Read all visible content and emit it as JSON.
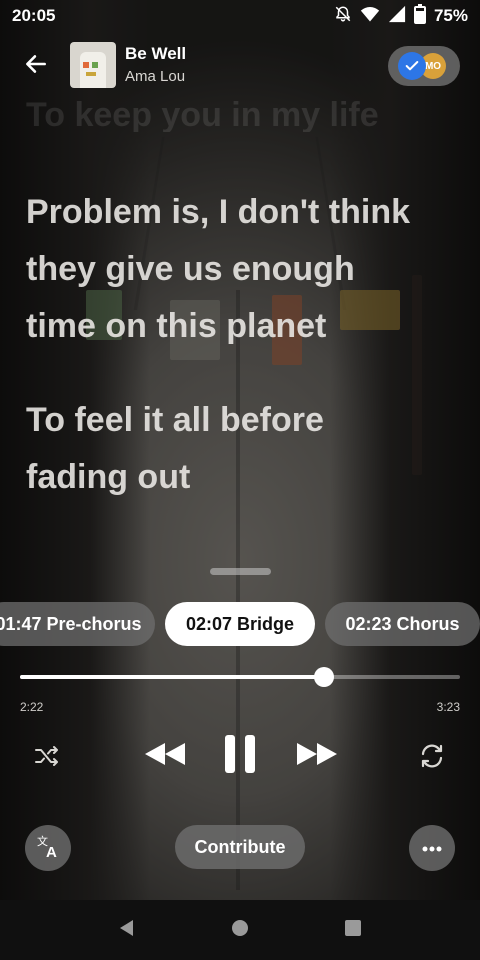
{
  "status_bar": {
    "time": "20:05",
    "battery": "75%"
  },
  "header": {
    "title": "Be Well",
    "artist": "Ama Lou",
    "toggle_badge": "MO"
  },
  "lyrics": {
    "previous_line_faded": "To keep you in my life",
    "current_lines": [
      "Problem is, I don't think",
      "they give us enough",
      "time on this planet"
    ],
    "next_lines": [
      "To feel it all before",
      "fading out"
    ]
  },
  "sections": [
    {
      "label": "01:47 Pre-chorus",
      "active": false
    },
    {
      "label": "02:07 Bridge",
      "active": true
    },
    {
      "label": "02:23 Chorus",
      "active": false
    }
  ],
  "playback": {
    "elapsed": "2:22",
    "duration": "3:23",
    "progress_fraction": 0.69
  },
  "bottom": {
    "contribute_label": "Contribute"
  },
  "icons": {
    "back": "arrow-left-icon",
    "shuffle": "shuffle-icon",
    "previous": "rewind-icon",
    "pause": "pause-icon",
    "next": "fast-forward-icon",
    "repeat": "repeat-icon",
    "translate": "translate-icon",
    "more": "more-horizontal-icon"
  },
  "colors": {
    "accent_blue": "#2d76e6",
    "badge_gold": "#d9a13a"
  }
}
